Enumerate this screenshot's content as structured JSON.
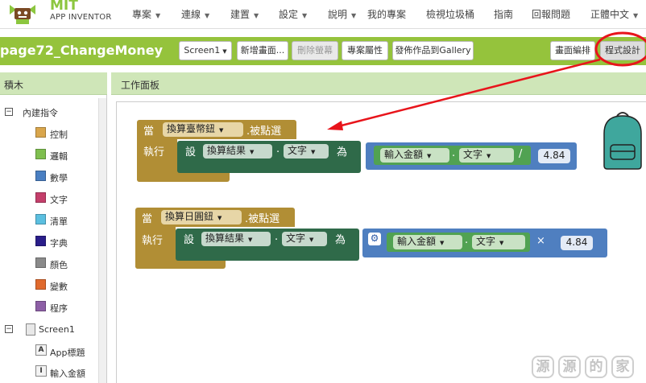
{
  "logo": {
    "mit": "MIT",
    "app_inventor": "APP INVENTOR"
  },
  "nav": {
    "items": [
      {
        "label": "專案",
        "dropdown": true
      },
      {
        "label": "連線",
        "dropdown": true
      },
      {
        "label": "建置",
        "dropdown": true
      },
      {
        "label": "設定",
        "dropdown": true
      },
      {
        "label": "說明",
        "dropdown": true
      },
      {
        "label": "我的專案",
        "dropdown": false
      },
      {
        "label": "檢視垃圾桶",
        "dropdown": false
      },
      {
        "label": "指南",
        "dropdown": false
      },
      {
        "label": "回報問題",
        "dropdown": false
      },
      {
        "label": "正體中文",
        "dropdown": true
      }
    ]
  },
  "project": {
    "name": "page72_ChangeMoney",
    "screen_select": "Screen1",
    "add_screen": "新增畫面...",
    "remove_screen": "刪除螢幕",
    "properties": "專案屬性",
    "publish": "發佈作品到Gallery",
    "designer": "畫面編排",
    "blocks": "程式設計"
  },
  "blocks_panel": {
    "title": "積木",
    "builtin": "內建指令",
    "categories": [
      {
        "label": "控制",
        "color": "#d9a64c"
      },
      {
        "label": "邏輯",
        "color": "#7fbf4f"
      },
      {
        "label": "數學",
        "color": "#4a7fc2"
      },
      {
        "label": "文字",
        "color": "#c43f6b"
      },
      {
        "label": "清單",
        "color": "#5bbfe0"
      },
      {
        "label": "字典",
        "color": "#2a1e8a"
      },
      {
        "label": "顏色",
        "color": "#8a8a8a"
      },
      {
        "label": "變數",
        "color": "#e06a2d"
      },
      {
        "label": "程序",
        "color": "#8d5fa6"
      }
    ],
    "screen": "Screen1",
    "components": [
      {
        "label": "App標題",
        "icon": "A"
      },
      {
        "label": "輸入金額",
        "icon": "I"
      }
    ]
  },
  "workspace": {
    "title": "工作面板",
    "block1": {
      "when": "當",
      "component": "換算臺幣鈕",
      "event": ".被點選",
      "do": "執行",
      "set": "設",
      "target": "換算結果",
      "dot": ".",
      "prop": "文字",
      "to": "為",
      "source": "輸入金額",
      "source_prop": "文字",
      "op": "/",
      "number": "4.84"
    },
    "block2": {
      "when": "當",
      "component": "換算日圓鈕",
      "event": ".被點選",
      "do": "執行",
      "set": "設",
      "target": "換算結果",
      "dot": ".",
      "prop": "文字",
      "to": "為",
      "source": "輸入金額",
      "source_prop": "文字",
      "op": "×",
      "number": "4.84"
    }
  },
  "watermark": {
    "chars": [
      "源",
      "源",
      "的",
      "家"
    ]
  },
  "colors": {
    "brand_green": "#95c33c",
    "panel_header": "#cfe6b8",
    "event_block": "#b18e35",
    "setter_block": "#2f6a49",
    "math_block": "#4f7fc0",
    "getter_block": "#51a252",
    "annotation_red": "#e8141b"
  }
}
